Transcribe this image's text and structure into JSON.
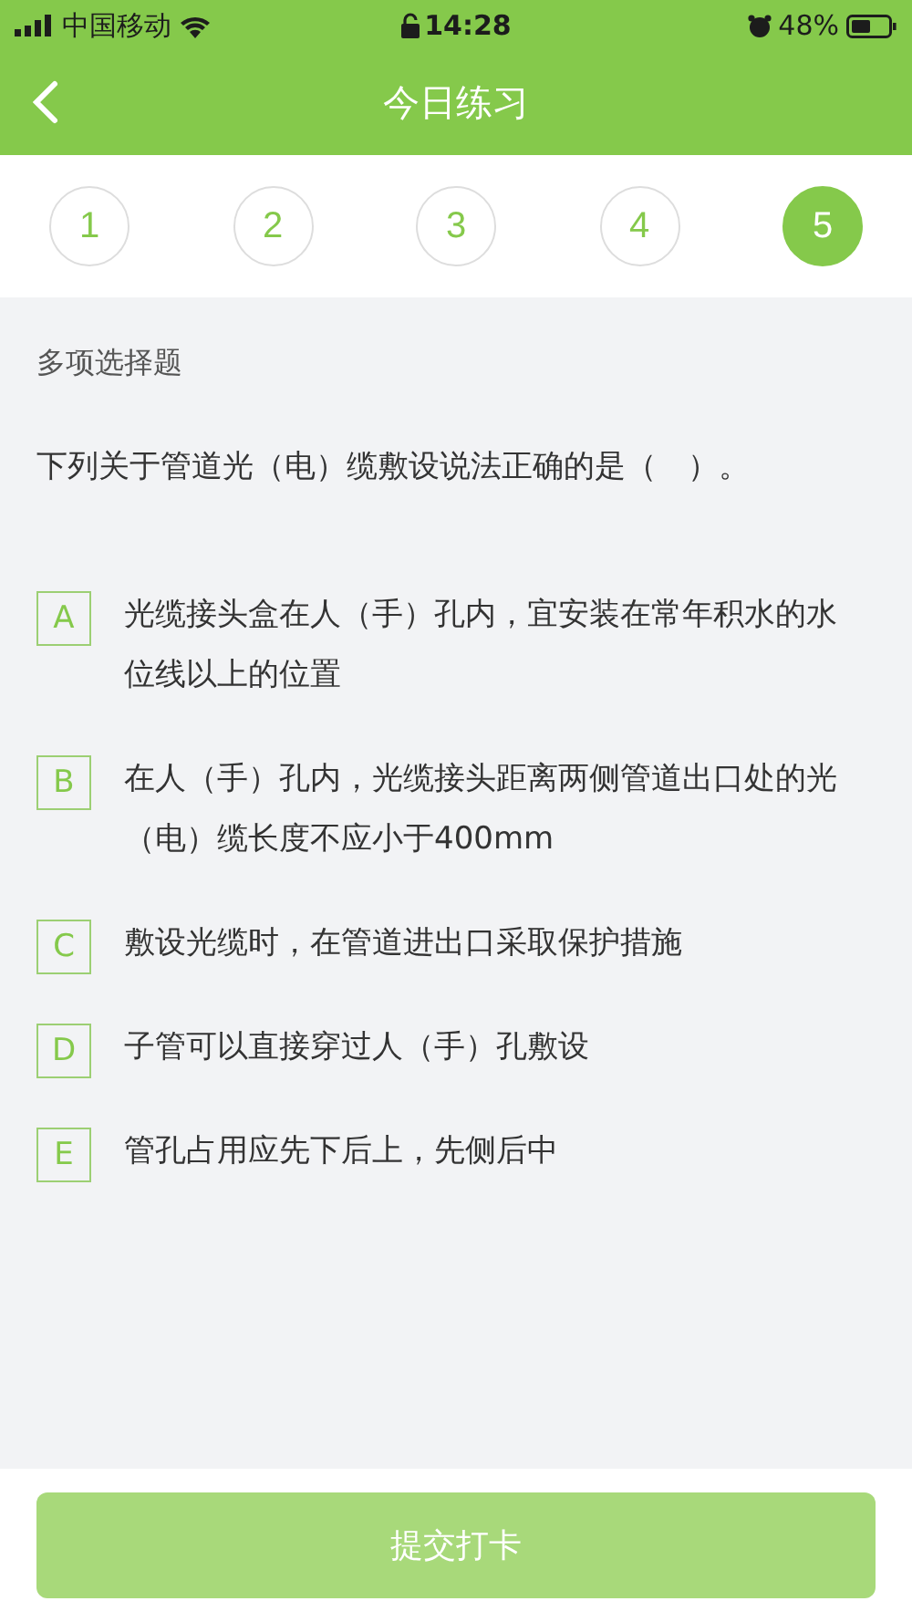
{
  "status_bar": {
    "carrier": "中国移动",
    "time": "14:28",
    "battery": "48%"
  },
  "nav": {
    "title": "今日练习"
  },
  "steps": [
    {
      "label": "1",
      "selected": false
    },
    {
      "label": "2",
      "selected": false
    },
    {
      "label": "3",
      "selected": false
    },
    {
      "label": "4",
      "selected": false
    },
    {
      "label": "5",
      "selected": true
    }
  ],
  "question": {
    "type": "多项选择题",
    "text": "下列关于管道光（电）缆敷设说法正确的是（　）。"
  },
  "options": [
    {
      "letter": "A",
      "text": "光缆接头盒在人（手）孔内，宜安装在常年积水的水位线以上的位置",
      "selected": false
    },
    {
      "letter": "B",
      "text": "在人（手）孔内，光缆接头距离两侧管道出口处的光（电）缆长度不应小于400mm",
      "selected": false
    },
    {
      "letter": "C",
      "text": "敷设光缆时，在管道进出口采取保护措施",
      "selected": false
    },
    {
      "letter": "D",
      "text": "子管可以直接穿过人（手）孔敷设",
      "selected": false
    },
    {
      "letter": "E",
      "text": "管孔占用应先下后上，先侧后中",
      "selected": false
    }
  ],
  "submit": {
    "label": "提交打卡",
    "disabled": true
  }
}
